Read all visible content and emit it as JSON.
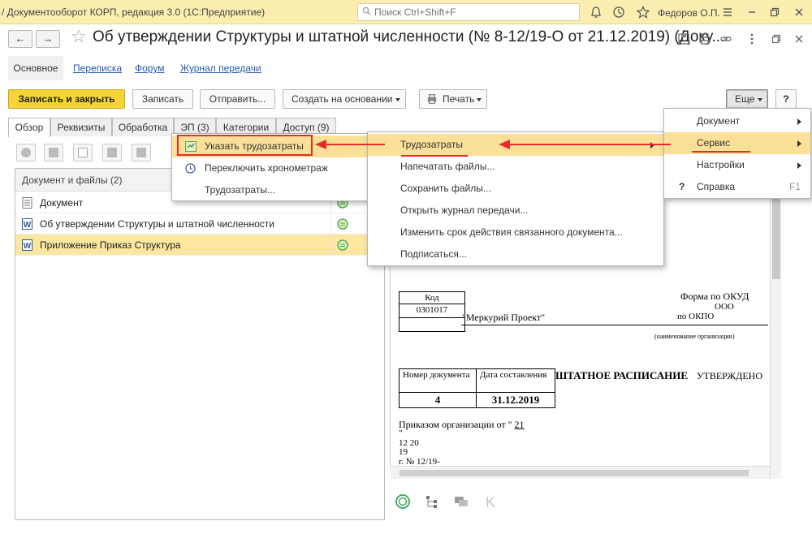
{
  "window": {
    "title": "/ Документооборот КОРП, редакция 3.0  (1С:Предприятие)",
    "search_placeholder": "Поиск Ctrl+Shift+F",
    "user": "Федоров О.П."
  },
  "header": {
    "title": "Об утверждении Структуры и штатной численности (№ 8-12/19-О от 21.12.2019) (Доку...",
    "back": "←",
    "forward": "→",
    "star": "☆"
  },
  "sections": {
    "main": "Основное",
    "correspondence": "Переписка",
    "forum": "Форум",
    "transfer_log": "Журнал передачи"
  },
  "toolbar": {
    "save_close": "Записать и закрыть",
    "save": "Записать",
    "send": "Отправить...",
    "create_based": "Создать на основании",
    "print": "Печать",
    "more": "Еще",
    "help": "?"
  },
  "tabs": [
    "Обзор",
    "Реквизиты",
    "Обработка",
    "ЭП (3)",
    "Категории",
    "Доступ (9)"
  ],
  "files": {
    "header": "Документ и файлы (2)",
    "rows": [
      {
        "name": "Документ",
        "type": "doc"
      },
      {
        "name": "Об утверждении Структуры и штатной численности",
        "type": "word"
      },
      {
        "name": "Приложение Приказ Структура",
        "type": "word"
      }
    ]
  },
  "menus": {
    "more": [
      {
        "label": "Документ",
        "submenu": true
      },
      {
        "label": "Сервис",
        "submenu": true
      },
      {
        "label": "Настройки",
        "submenu": true
      },
      {
        "label": "Справка",
        "shortcut": "F1",
        "icon": "?"
      }
    ],
    "service": [
      {
        "label": "Трудозатраты"
      },
      {
        "label": "Напечатать файлы..."
      },
      {
        "label": "Сохранить файлы..."
      },
      {
        "label": "Открыть журнал передачи..."
      },
      {
        "label": "Изменить срок действия связанного документа..."
      },
      {
        "label": "Подписаться..."
      }
    ],
    "labor": [
      {
        "label": "Указать трудозатраты"
      },
      {
        "label": "Переключить хронометраж"
      },
      {
        "label": "Трудозатраты..."
      }
    ]
  },
  "preview": {
    "code_header": "Код",
    "form_okud": "Форма по ОКУД",
    "code_value": "0301017",
    "ooo": "ООО",
    "org_name": "\"Меркурий Проект\"",
    "okpo": "по ОКПО",
    "org_caption": "(наименование организации)",
    "doc_number_label": "Номер документа",
    "doc_date_label": "Дата составления",
    "title": "ШТАТНОЕ РАСПИСАНИЕ",
    "approved": "УТВЕРЖДЕНО",
    "number": "4",
    "date": "31.12.2019",
    "order_line": "Приказом организации от \"",
    "order_day": "21",
    "quote": "\"",
    "line_12_20": "12 20",
    "line_19": "19",
    "line_num": "г. № 12/19-"
  },
  "colors": {
    "accent": "#f6d435",
    "highlight": "#fbe098",
    "annotation": "#e62b2b",
    "titlebar": "#fbeeb0"
  }
}
